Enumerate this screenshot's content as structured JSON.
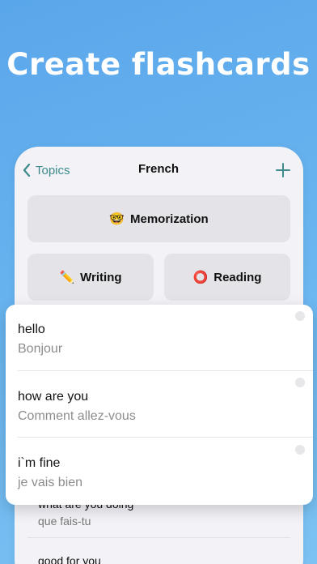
{
  "headline": "Create flashcards",
  "nav": {
    "back_label": "Topics",
    "title": "French"
  },
  "modes": [
    {
      "emoji": "🤓",
      "label": "Memorization"
    },
    {
      "emoji": "✏️",
      "label": "Writing"
    },
    {
      "emoji": "⭕",
      "label": "Reading"
    }
  ],
  "cards": [
    {
      "word": "hello",
      "translation": "Bonjour"
    },
    {
      "word": "how are you",
      "translation": "Comment allez-vous"
    },
    {
      "word": "i`m fine",
      "translation": "je vais bien"
    }
  ],
  "background_cards": [
    {
      "word": "what are you doing",
      "translation": "que fais-tu"
    },
    {
      "word": "good for you",
      "translation": ""
    }
  ],
  "colors": {
    "accent": "#3c8a8c",
    "background_top": "#5aa6ea",
    "background_bottom": "#7cc3f3"
  }
}
